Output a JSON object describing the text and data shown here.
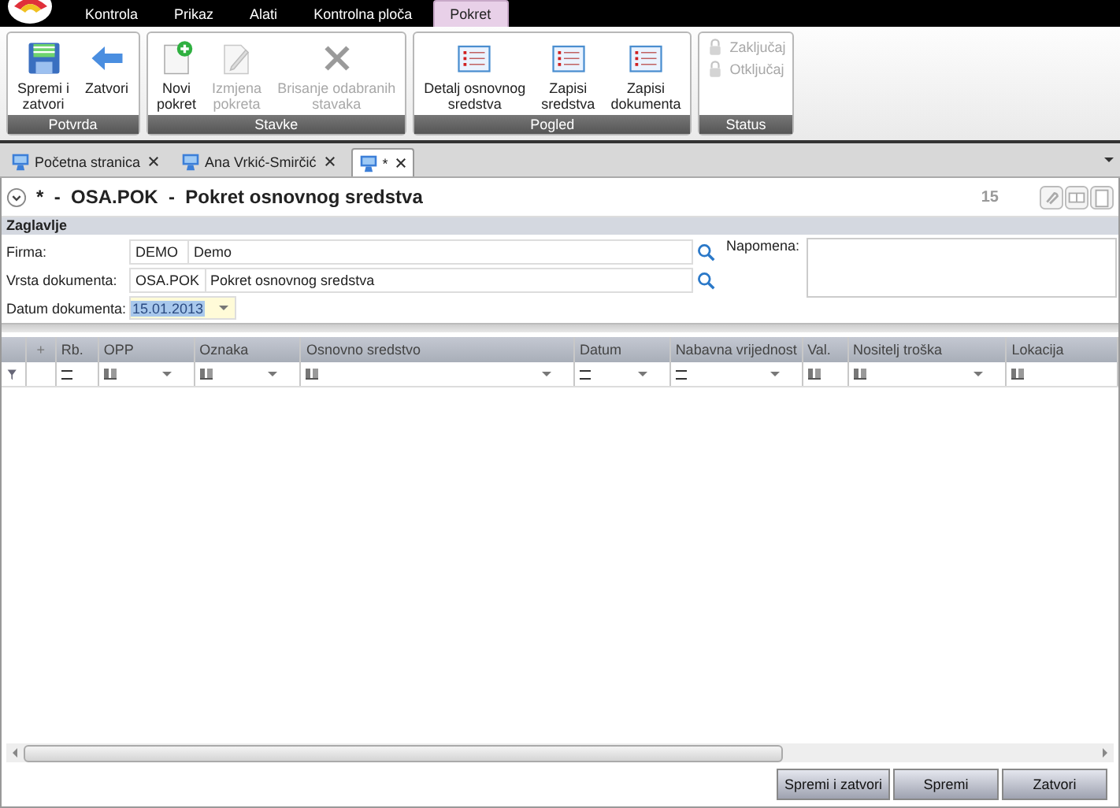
{
  "menu": [
    {
      "label": "Kontrola",
      "selected": false
    },
    {
      "label": "Prikaz",
      "selected": false
    },
    {
      "label": "Alati",
      "selected": false
    },
    {
      "label": "Kontrolna ploča",
      "selected": false
    },
    {
      "label": "Pokret",
      "selected": true
    }
  ],
  "ribbon": [
    {
      "title": "Potvrda",
      "kind": "large",
      "buttons": [
        {
          "label": "Spremi i\nzatvori",
          "disabled": false
        },
        {
          "label": "Zatvori",
          "disabled": false
        }
      ]
    },
    {
      "title": "Stavke",
      "kind": "large",
      "buttons": [
        {
          "label": "Novi\npokret",
          "disabled": false
        },
        {
          "label": "Izmjena\npokreta",
          "disabled": true
        },
        {
          "label": "Brisanje odabranih\nstavaka",
          "disabled": true
        }
      ]
    },
    {
      "title": "Pogled",
      "kind": "large",
      "buttons": [
        {
          "label": "Detalj osnovnog\nsredstva",
          "disabled": false
        },
        {
          "label": "Zapisi\nsredstva",
          "disabled": false
        },
        {
          "label": "Zapisi\ndokumenta",
          "disabled": false
        }
      ]
    },
    {
      "title": "Status",
      "kind": "small",
      "buttons": [
        {
          "label": "Zaključaj",
          "disabled": true
        },
        {
          "label": "Otključaj",
          "disabled": true
        }
      ]
    }
  ],
  "doc_tabs": [
    {
      "label": "Početna stranica",
      "selected": false
    },
    {
      "label": "Ana Vrkić-Smirčić",
      "selected": false
    },
    {
      "label": "*",
      "selected": true
    }
  ],
  "document": {
    "title": "*  -  OSA.POK  -  Pokret osnovnog sredstva",
    "number": "15"
  },
  "section": "Zaglavlje",
  "fields": [
    {
      "label": "Firma:",
      "code": "DEMO",
      "value": "Demo",
      "kind": "lookup"
    },
    {
      "label": "Vrsta dokumenta:",
      "code": "OSA.POK",
      "value": "Pokret osnovnog sredstva",
      "kind": "lookup"
    },
    {
      "label": "Datum dokumenta:",
      "value": "15.01.2013",
      "kind": "date"
    }
  ],
  "note": {
    "label": "Napomena:"
  },
  "grid": {
    "columns": [
      {
        "label": "+",
        "kind": "plain",
        "dropdown": false
      },
      {
        "label": "Rb.",
        "kind": "equals",
        "dropdown": false
      },
      {
        "label": "OPP",
        "kind": "text",
        "dropdown": true
      },
      {
        "label": "Oznaka",
        "kind": "text",
        "dropdown": true
      },
      {
        "label": "Osnovno sredstvo",
        "kind": "text",
        "dropdown": true
      },
      {
        "label": "Datum",
        "kind": "equals",
        "dropdown": true
      },
      {
        "label": "Nabavna vrijednost",
        "kind": "equals",
        "dropdown": true
      },
      {
        "label": "Val.",
        "kind": "text",
        "dropdown": false
      },
      {
        "label": "Nositelj troška",
        "kind": "text",
        "dropdown": true
      },
      {
        "label": "Lokacija",
        "kind": "text",
        "dropdown": false
      }
    ]
  },
  "buttons": [
    "Spremi i zatvori",
    "Spremi",
    "Zatvori"
  ]
}
